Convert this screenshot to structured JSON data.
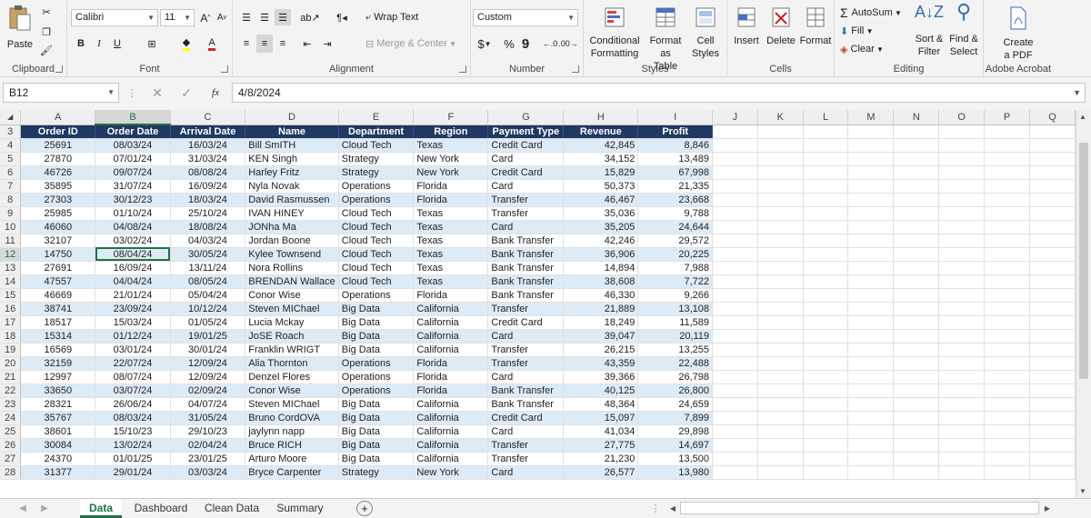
{
  "ribbon": {
    "clipboard": {
      "label": "Clipboard",
      "paste": "Paste"
    },
    "font": {
      "label": "Font",
      "family": "Calibri",
      "size": "11",
      "bold": "B",
      "italic": "I",
      "underline": "U",
      "grow": "A",
      "shrink": "A",
      "font_color_glyph": "A"
    },
    "alignment": {
      "label": "Alignment",
      "wrap_text": "Wrap Text",
      "merge_center": "Merge & Center"
    },
    "number": {
      "label": "Number",
      "format": "Custom",
      "currency": "$",
      "percent": "%",
      "comma": "9"
    },
    "styles": {
      "label": "Styles",
      "conditional": "Conditional",
      "conditional2": "Formatting",
      "format_table": "Format as",
      "format_table2": "Table",
      "cell_styles": "Cell",
      "cell_styles2": "Styles"
    },
    "cells": {
      "label": "Cells",
      "insert": "Insert",
      "delete": "Delete",
      "format": "Format"
    },
    "editing": {
      "label": "Editing",
      "autosum": "AutoSum",
      "fill": "Fill",
      "clear": "Clear",
      "sort": "Sort &",
      "sort2": "Filter",
      "find": "Find &",
      "find2": "Select"
    },
    "acrobat": {
      "label": "Adobe Acrobat",
      "create": "Create",
      "create2": "a PDF"
    }
  },
  "formula_bar": {
    "name_box": "B12",
    "fx": "fx",
    "value": "4/8/2024"
  },
  "sheet": {
    "columns": [
      "A",
      "B",
      "C",
      "D",
      "E",
      "F",
      "G",
      "H",
      "I",
      "J",
      "K",
      "L",
      "M",
      "N",
      "O",
      "P",
      "Q"
    ],
    "header_row_number": "3",
    "headers": [
      "Order ID",
      "Order Date",
      "Arrival Date",
      "Name",
      "Department",
      "Region",
      "Payment Type",
      "Revenue",
      "Profit"
    ],
    "rows": [
      {
        "n": "4",
        "c": [
          "25691",
          "08/03/24",
          "16/03/24",
          "Bill SmITH",
          "Cloud Tech",
          "Texas",
          "Credit Card",
          "42,845",
          "8,846"
        ]
      },
      {
        "n": "5",
        "c": [
          "27870",
          "07/01/24",
          "31/03/24",
          "KEN Singh",
          "Strategy",
          "New York",
          "Card",
          "34,152",
          "13,489"
        ]
      },
      {
        "n": "6",
        "c": [
          "46726",
          "09/07/24",
          "08/08/24",
          "Harley  Fritz",
          "Strategy",
          "New York",
          "Credit Card",
          "15,829",
          "67,998"
        ]
      },
      {
        "n": "7",
        "c": [
          "35895",
          "31/07/24",
          "16/09/24",
          "Nyla Novak",
          "Operations",
          "Florida",
          "Card",
          "50,373",
          "21,335"
        ]
      },
      {
        "n": "8",
        "c": [
          "27303",
          "30/12/23",
          "18/03/24",
          "David  Rasmussen",
          "Operations",
          "Florida",
          "Transfer",
          "46,467",
          "23,668"
        ]
      },
      {
        "n": "9",
        "c": [
          "25985",
          "01/10/24",
          "25/10/24",
          "IVAN HINEY",
          "Cloud Tech",
          "Texas",
          "Transfer",
          "35,036",
          "9,788"
        ]
      },
      {
        "n": "10",
        "c": [
          "46060",
          "04/08/24",
          "18/08/24",
          "JONha Ma",
          "Cloud Tech",
          "Texas",
          "Card",
          "35,205",
          "24,644"
        ]
      },
      {
        "n": "11",
        "c": [
          "32107",
          "03/02/24",
          "04/03/24",
          "Jordan Boone",
          "Cloud Tech",
          "Texas",
          "Bank Transfer",
          "42,246",
          "29,572"
        ]
      },
      {
        "n": "12",
        "c": [
          "14750",
          "08/04/24",
          "30/05/24",
          "Kylee Townsend",
          "Cloud Tech",
          "Texas",
          "Bank Transfer",
          "36,906",
          "20,225"
        ]
      },
      {
        "n": "13",
        "c": [
          "27691",
          "16/09/24",
          "13/11/24",
          "Nora Rollins",
          "Cloud Tech",
          "Texas",
          "Bank Transfer",
          "14,894",
          "7,988"
        ]
      },
      {
        "n": "14",
        "c": [
          "47557",
          "04/04/24",
          "08/05/24",
          "BRENDAN Wallace",
          "Cloud Tech",
          "Texas",
          "Bank Transfer",
          "38,608",
          "7,722"
        ]
      },
      {
        "n": "15",
        "c": [
          "46669",
          "21/01/24",
          "05/04/24",
          "Conor Wise",
          "Operations",
          "Florida",
          "Bank Transfer",
          "46,330",
          "9,266"
        ]
      },
      {
        "n": "16",
        "c": [
          "38741",
          "23/09/24",
          "10/12/24",
          "Steven  MIChael",
          "Big Data",
          "California",
          "Transfer",
          "21,889",
          "13,108"
        ]
      },
      {
        "n": "17",
        "c": [
          "18517",
          "15/03/24",
          "01/05/24",
          "Lucia Mckay",
          "Big Data",
          "California",
          "Credit Card",
          "18,249",
          "11,589"
        ]
      },
      {
        "n": "18",
        "c": [
          "15314",
          "01/12/24",
          "19/01/25",
          "JoSE  Roach",
          "Big Data",
          "California",
          "Card",
          "39,047",
          "20,119"
        ]
      },
      {
        "n": "19",
        "c": [
          "16569",
          "03/01/24",
          "30/01/24",
          "Franklin WRIGT",
          "Big Data",
          "California",
          "Transfer",
          "26,215",
          "13,255"
        ]
      },
      {
        "n": "20",
        "c": [
          "32159",
          "22/07/24",
          "12/09/24",
          "Alia  Thornton",
          "Operations",
          "Florida",
          "Transfer",
          "43,359",
          "22,488"
        ]
      },
      {
        "n": "21",
        "c": [
          "12997",
          "08/07/24",
          "12/09/24",
          "Denzel  Flores",
          "Operations",
          "Florida",
          "Card",
          "39,366",
          "26,798"
        ]
      },
      {
        "n": "22",
        "c": [
          "33650",
          "03/07/24",
          "02/09/24",
          "Conor Wise",
          "Operations",
          "Florida",
          "Bank Transfer",
          "40,125",
          "26,800"
        ]
      },
      {
        "n": "23",
        "c": [
          "28321",
          "26/06/24",
          "04/07/24",
          "Steven  MIChael",
          "Big Data",
          "California",
          "Bank Transfer",
          "48,364",
          "24,659"
        ]
      },
      {
        "n": "24",
        "c": [
          "35767",
          "08/03/24",
          "31/05/24",
          "Bruno CordOVA",
          "Big Data",
          "California",
          "Credit Card",
          "15,097",
          "7,899"
        ]
      },
      {
        "n": "25",
        "c": [
          "38601",
          "15/10/23",
          "29/10/23",
          "jaylynn  napp",
          "Big Data",
          "California",
          "Card",
          "41,034",
          "29,898"
        ]
      },
      {
        "n": "26",
        "c": [
          "30084",
          "13/02/24",
          "02/04/24",
          "Bruce RICH",
          "Big Data",
          "California",
          "Transfer",
          "27,775",
          "14,697"
        ]
      },
      {
        "n": "27",
        "c": [
          "24370",
          "01/01/25",
          "23/01/25",
          "Arturo Moore",
          "Big Data",
          "California",
          "Transfer",
          "21,230",
          "13,500"
        ]
      },
      {
        "n": "28",
        "c": [
          "31377",
          "29/01/24",
          "03/03/24",
          "Bryce  Carpenter",
          "Strategy",
          "New York",
          "Card",
          "26,577",
          "13,980"
        ]
      }
    ]
  },
  "tabs": [
    "Data",
    "Dashboard",
    "Clean Data",
    "Summary"
  ],
  "colors": {
    "header_fill": "#1f3864",
    "band_fill": "#ddebf7",
    "accent": "#217346"
  }
}
